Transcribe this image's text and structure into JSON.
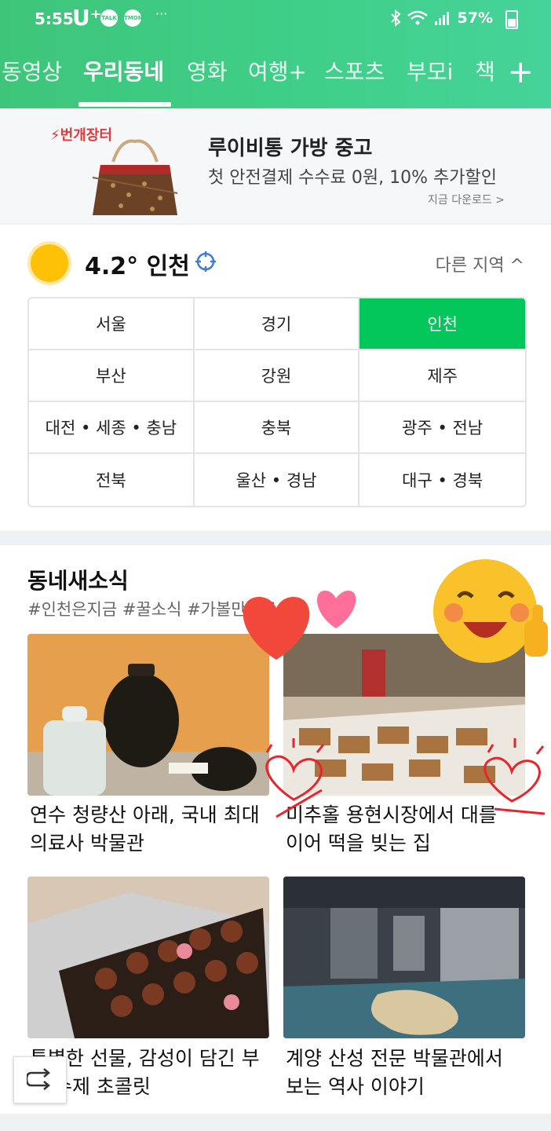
{
  "status": {
    "time": "5:55",
    "carrier": "U⁺",
    "app1": "TALK",
    "app2": "TMON",
    "more": "···",
    "battery": "57%"
  },
  "tabs": [
    "동영상",
    "우리동네",
    "영화",
    "여행+",
    "스포츠",
    "부모i",
    "책"
  ],
  "active_tab": "우리동네",
  "ad": {
    "logo": "번개장터",
    "title": "루이비통 가방 중고",
    "subtitle": "첫 안전결제 수수료 0원, 10% 추가할인",
    "link": "지금 다운로드 >"
  },
  "weather": {
    "temp_city": "4.2°  인천",
    "other_region": "다른 지역 ^",
    "regions": [
      "서울",
      "경기",
      "인천",
      "부산",
      "강원",
      "제주",
      "대전 • 세종 • 충남",
      "충북",
      "광주 • 전남",
      "전북",
      "울산 • 경남",
      "대구 • 경북"
    ],
    "selected": "인천"
  },
  "news": {
    "title": "동네새소식",
    "tags": "#인천은지금 #꿀소식 #가볼만한곳",
    "cards": [
      {
        "line1": "연수 청량산 아래, 국내 최대",
        "line2": "의료사 박물관"
      },
      {
        "line1": "미추홀 용현시장에서 대를",
        "line2": "이어 떡을 빚는 집"
      },
      {
        "line1": "특별한 선물, 감성이 담긴 부",
        "line2": "평 수제 초콜릿"
      },
      {
        "line1": "계양 산성 전문 박물관에서",
        "line2": "보는 역사 이야기"
      }
    ]
  },
  "colors": {
    "header_green": "#3fcf88",
    "selected_green": "#03c75a",
    "ad_red": "#e23a3a"
  }
}
